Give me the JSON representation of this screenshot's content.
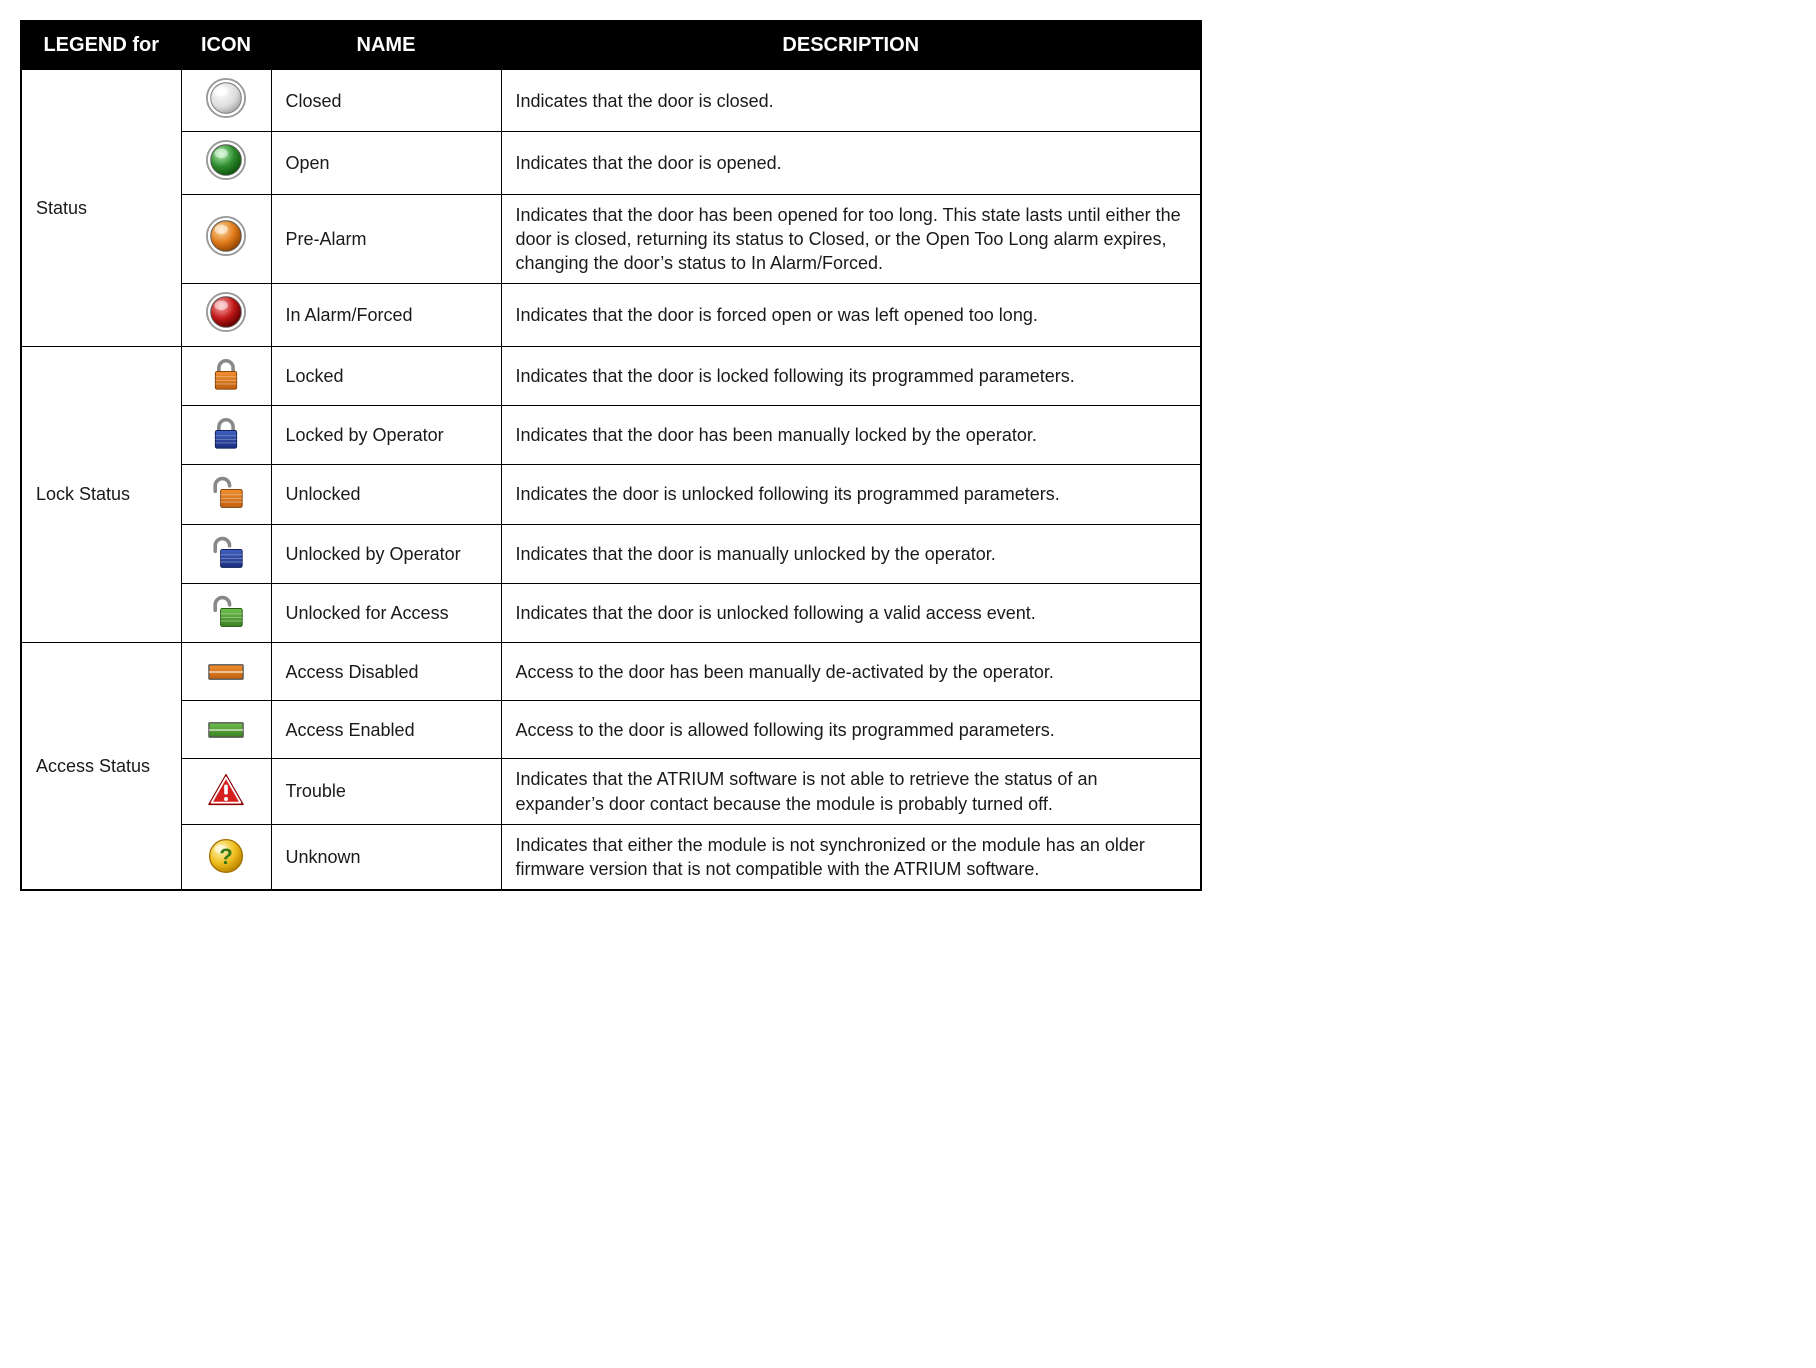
{
  "headers": {
    "legend": "LEGEND for",
    "icon": "ICON",
    "name": "NAME",
    "description": "DESCRIPTION"
  },
  "groups": [
    {
      "legend": "Status",
      "rows": [
        {
          "icon": "status-closed",
          "name": "Closed",
          "description": "Indicates that the door is closed."
        },
        {
          "icon": "status-open",
          "name": "Open",
          "description": "Indicates that the door is opened."
        },
        {
          "icon": "status-prealarm",
          "name": "Pre-Alarm",
          "description": "Indicates that the door has been opened for too long. This state lasts until either the door is closed, returning its status to Closed, or the Open Too Long alarm expires, changing the door’s status to In Alarm/Forced."
        },
        {
          "icon": "status-alarm",
          "name": "In Alarm/Forced",
          "description": "Indicates that the door is forced open or was left opened too long."
        }
      ]
    },
    {
      "legend": "Lock Status",
      "rows": [
        {
          "icon": "lock-locked",
          "name": "Locked",
          "description": "Indicates that the door is locked following its programmed parameters."
        },
        {
          "icon": "lock-locked-operator",
          "name": "Locked by Operator",
          "description": "Indicates that the door has been manually locked by the operator."
        },
        {
          "icon": "lock-unlocked",
          "name": "Unlocked",
          "description": "Indicates the door is unlocked following its programmed parameters."
        },
        {
          "icon": "lock-unlocked-operator",
          "name": "Unlocked by Operator",
          "description": "Indicates that the door is manually unlocked by the operator."
        },
        {
          "icon": "lock-unlocked-access",
          "name": "Unlocked for Access",
          "description": "Indicates that the door is unlocked following a valid access event."
        }
      ]
    },
    {
      "legend": "Access Status",
      "rows": [
        {
          "icon": "access-disabled",
          "name": "Access Disabled",
          "description": "Access to the door has been manually de-activated by the operator."
        },
        {
          "icon": "access-enabled",
          "name": "Access Enabled",
          "description": "Access to the door is allowed following its programmed parameters."
        },
        {
          "icon": "trouble",
          "name": "Trouble",
          "description": "Indicates that the ATRIUM software is not able to retrieve the status of an expander’s door contact because the module is probably turned off."
        },
        {
          "icon": "unknown",
          "name": "Unknown",
          "description": "Indicates that either the module is not synchronized or the module has an older firmware version that is not compatible with the ATRIUM software."
        }
      ]
    }
  ]
}
